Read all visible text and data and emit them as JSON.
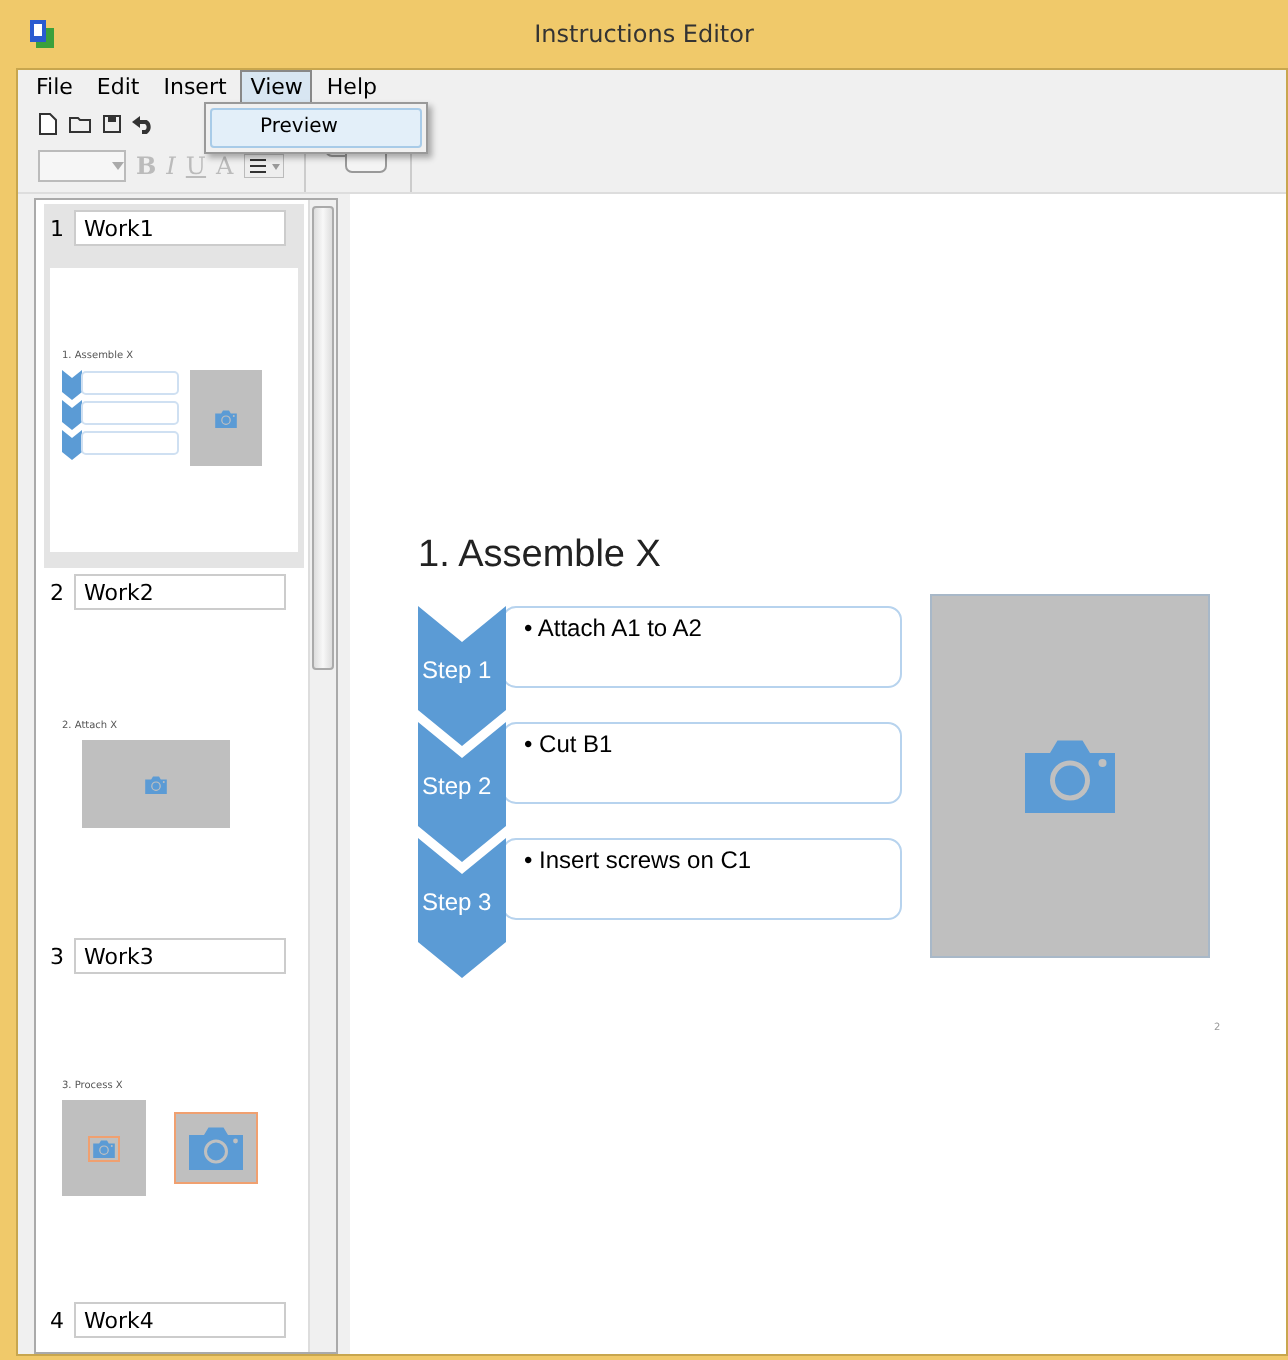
{
  "window": {
    "title": "Instructions Editor"
  },
  "menu": [
    {
      "label": "File",
      "selected": false
    },
    {
      "label": "Edit",
      "selected": false
    },
    {
      "label": "Insert",
      "selected": false
    },
    {
      "label": "View",
      "selected": true
    },
    {
      "label": "Help",
      "selected": false
    }
  ],
  "dropdown": {
    "items": [
      "Preview"
    ]
  },
  "format_buttons": [
    {
      "label": "B",
      "disabled": true
    },
    {
      "label": "I",
      "disabled": true
    },
    {
      "label": "U",
      "disabled": true
    },
    {
      "label": "A",
      "disabled": true
    }
  ],
  "slides": [
    {
      "number": "1",
      "name": "Work1",
      "selected": true,
      "kind": "steps",
      "title": "1. Assemble X"
    },
    {
      "number": "2",
      "name": "Work2",
      "selected": false,
      "kind": "photo",
      "title": "2. Attach X"
    },
    {
      "number": "3",
      "name": "Work3",
      "selected": false,
      "kind": "zoom",
      "title": "3. Process X"
    },
    {
      "number": "4",
      "name": "Work4",
      "selected": false,
      "kind": "hidden"
    }
  ],
  "editor": {
    "title": "1. Assemble X",
    "page": "2",
    "steps": [
      {
        "label": "Step 1",
        "text": "• Attach A1 to A2"
      },
      {
        "label": "Step 2",
        "text": "• Cut B1"
      },
      {
        "label": "Step 3",
        "text": "• Insert screws on C1"
      }
    ]
  }
}
